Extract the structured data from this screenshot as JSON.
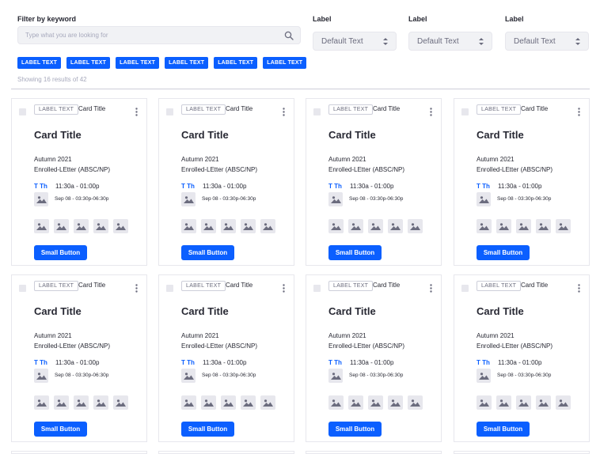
{
  "filter": {
    "keyword_label": "Filter by keyword",
    "search_placeholder": "Type what you are looking for",
    "selects": [
      {
        "label": "Label",
        "value": "Default Text"
      },
      {
        "label": "Label",
        "value": "Default Text"
      },
      {
        "label": "Label",
        "value": "Default Text"
      }
    ],
    "chips": [
      "LABEL TEXT",
      "LABEL TEXT",
      "LABEL TEXT",
      "LABEL TEXT",
      "LABEL TEXT",
      "LABEL TEXT"
    ],
    "results_text": "Showing 16 results of 42"
  },
  "cards": [
    {
      "label_tag": "LABEL TEXT",
      "small_title": "Card Title",
      "title": "Card Title",
      "term": "Autumn 2021",
      "enrollment": "Enrolled-LEtter (ABSC/NP)",
      "days": "T Th",
      "time": "11:30a - 01:00p",
      "date": "Sep 08 - 03:30p-06:30p",
      "button": "Small Button"
    },
    {
      "label_tag": "LABEL TEXT",
      "small_title": "Card Title",
      "title": "Card Title",
      "term": "Autumn 2021",
      "enrollment": "Enrolled-LEtter (ABSC/NP)",
      "days": "T Th",
      "time": "11:30a - 01:00p",
      "date": "Sep 08 - 03:30p-06:30p",
      "button": "Small Button"
    },
    {
      "label_tag": "LABEL TEXT",
      "small_title": "Card Title",
      "title": "Card Title",
      "term": "Autumn 2021",
      "enrollment": "Enrolled-LEtter (ABSC/NP)",
      "days": "T Th",
      "time": "11:30a - 01:00p",
      "date": "Sep 08 - 03:30p-06:30p",
      "button": "Small Button"
    },
    {
      "label_tag": "LABEL TEXT",
      "small_title": "Card Title",
      "title": "Card Title",
      "term": "Autumn 2021",
      "enrollment": "Enrolled-LEtter (ABSC/NP)",
      "days": "T Th",
      "time": "11:30a - 01:00p",
      "date": "Sep 08 - 03:30p-06:30p",
      "button": "Small Button"
    },
    {
      "label_tag": "LABEL TEXT",
      "small_title": "Card Title",
      "title": "Card Title",
      "term": "Autumn 2021",
      "enrollment": "Enrolled-LEtter (ABSC/NP)",
      "days": "T Th",
      "time": "11:30a - 01:00p",
      "date": "Sep 08 - 03:30p-06:30p",
      "button": "Small Button"
    },
    {
      "label_tag": "LABEL TEXT",
      "small_title": "Card Title",
      "title": "Card Title",
      "term": "Autumn 2021",
      "enrollment": "Enrolled-LEtter (ABSC/NP)",
      "days": "T Th",
      "time": "11:30a - 01:00p",
      "date": "Sep 08 - 03:30p-06:30p",
      "button": "Small Button"
    },
    {
      "label_tag": "LABEL TEXT",
      "small_title": "Card Title",
      "title": "Card Title",
      "term": "Autumn 2021",
      "enrollment": "Enrolled-LEtter (ABSC/NP)",
      "days": "T Th",
      "time": "11:30a - 01:00p",
      "date": "Sep 08 - 03:30p-06:30p",
      "button": "Small Button"
    },
    {
      "label_tag": "LABEL TEXT",
      "small_title": "Card Title",
      "title": "Card Title",
      "term": "Autumn 2021",
      "enrollment": "Enrolled-LEtter (ABSC/NP)",
      "days": "T Th",
      "time": "11:30a - 01:00p",
      "date": "Sep 08 - 03:30p-06:30p",
      "button": "Small Button"
    }
  ],
  "icons": {
    "search": "search-icon",
    "caret": "caret-double-icon",
    "kebab": "ellipsis-v-icon",
    "image": "image-icon"
  },
  "colors": {
    "primary": "#0b5fff",
    "input_bg": "#f1f2f5",
    "placeholder": "#e7e7ed",
    "muted_text": "#a7a9bc"
  }
}
